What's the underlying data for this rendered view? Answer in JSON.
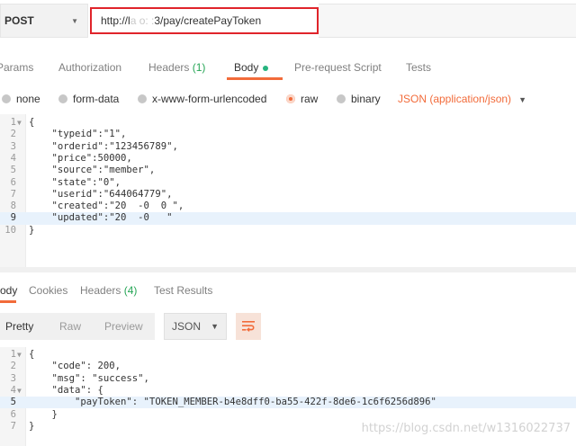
{
  "request": {
    "method": "POST",
    "url_prefix": "http://l",
    "url_blurred": "   a   o:  :  ",
    "url_suffix": "3/pay/createPayToken"
  },
  "request_tabs": [
    {
      "label": "Params"
    },
    {
      "label": "Authorization"
    },
    {
      "label": "Headers",
      "count": "(1)"
    },
    {
      "label": "Body",
      "active": true
    },
    {
      "label": "Pre-request Script"
    },
    {
      "label": "Tests"
    }
  ],
  "body_types": {
    "none": "none",
    "form_data": "form-data",
    "urlencoded": "x-www-form-urlencoded",
    "raw": "raw",
    "binary": "binary",
    "content_type": "JSON (application/json)"
  },
  "request_body_lines": [
    {
      "n": "1",
      "fold": true,
      "text": "{"
    },
    {
      "n": "2",
      "text": "    \"typeid\":\"1\","
    },
    {
      "n": "3",
      "text": "    \"orderid\":\"123456789\","
    },
    {
      "n": "4",
      "text": "    \"price\":50000,"
    },
    {
      "n": "5",
      "text": "    \"source\":\"member\","
    },
    {
      "n": "6",
      "text": "    \"state\":\"0\","
    },
    {
      "n": "7",
      "text": "    \"userid\":\"644064779\","
    },
    {
      "n": "8",
      "text": "    \"created\":\"20  -0  0 \","
    },
    {
      "n": "9",
      "text": "    \"updated\":\"20  -0   \"",
      "highlight": true
    },
    {
      "n": "10",
      "text": "}"
    }
  ],
  "response_tabs": [
    {
      "label": "Body",
      "active": true
    },
    {
      "label": "Cookies"
    },
    {
      "label": "Headers",
      "count": "(4)"
    },
    {
      "label": "Test Results"
    }
  ],
  "response_toolbar": {
    "pretty": "Pretty",
    "raw": "Raw",
    "preview": "Preview",
    "format": "JSON",
    "wrap_icon": "wrap-lines-icon"
  },
  "response_body_lines": [
    {
      "n": "1",
      "fold": true,
      "text": "{"
    },
    {
      "n": "2",
      "text": "    \"code\": 200,"
    },
    {
      "n": "3",
      "text": "    \"msg\": \"success\","
    },
    {
      "n": "4",
      "fold": true,
      "text": "    \"data\": {"
    },
    {
      "n": "5",
      "text": "        \"payToken\": \"TOKEN_MEMBER-b4e8dff0-ba55-422f-8de6-1c6f6256d896\"",
      "highlight": true
    },
    {
      "n": "6",
      "text": "    }"
    },
    {
      "n": "7",
      "text": "}"
    }
  ],
  "watermark": "https://blog.csdn.net/w1316022737",
  "colors": {
    "accent": "#f26b3a",
    "highlight_box": "#e0242b",
    "count_green": "#26a556",
    "line_highlight": "#e8f2fc"
  }
}
